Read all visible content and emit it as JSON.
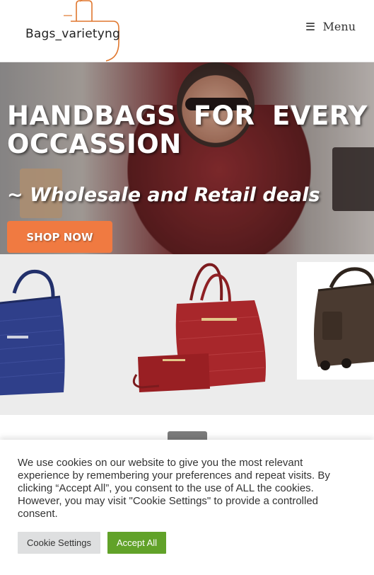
{
  "header": {
    "logo_text": "Bags_varietyng",
    "menu_label": "Menu"
  },
  "hero": {
    "title_line1_words": [
      "HANDBAGS",
      "FOR",
      "EVERY"
    ],
    "title_line2": "OCCASSION",
    "subtitle": "~ Wholesale and Retail deals",
    "cta_label": "SHOP NOW",
    "cta_color": "#f07a41"
  },
  "products": [
    {
      "name": "blue-woven-handbag",
      "color": "#2f3f8a"
    },
    {
      "name": "red-woven-handbag-set",
      "color": "#a8272b"
    },
    {
      "name": "brown-travel-bag",
      "color": "#4a3a30"
    }
  ],
  "cookie": {
    "message": "We use cookies on our website to give you the most relevant experience by remembering your preferences and repeat visits. By clicking “Accept All”, you consent to the use of ALL the cookies. However, you may visit \"Cookie Settings\" to provide a controlled consent.",
    "settings_label": "Cookie Settings",
    "accept_label": "Accept All",
    "accept_color": "#61a229"
  }
}
